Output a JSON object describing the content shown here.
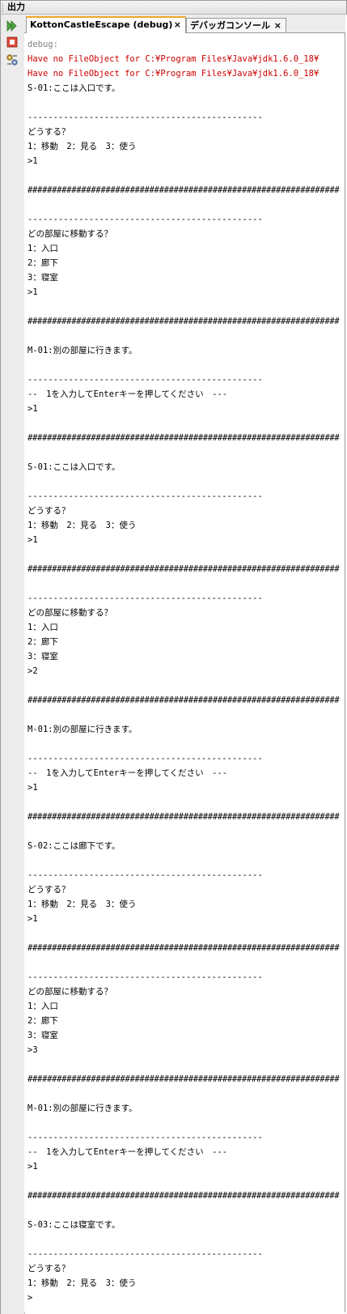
{
  "window": {
    "title": "出力"
  },
  "toolbar": {
    "buttons": [
      {
        "name": "rerun-icon"
      },
      {
        "name": "stop-icon"
      },
      {
        "name": "settings-icon"
      }
    ]
  },
  "tabs": [
    {
      "label": "KottonCastleEscape (debug)",
      "close": "×",
      "active": true
    },
    {
      "label": "デバッガコンソール",
      "close": "×",
      "active": false
    }
  ],
  "colors": {
    "debug_text": "#7f7f7f",
    "error_text": "#cc0000",
    "tab_accent": "#f5a623"
  },
  "console": {
    "lines": [
      {
        "text": "debug:",
        "type": "debug"
      },
      {
        "text": "Have no FileObject for C:¥Program Files¥Java¥jdk1.6.0_18¥",
        "type": "error"
      },
      {
        "text": "Have no FileObject for C:¥Program Files¥Java¥jdk1.6.0_18¥",
        "type": "error"
      },
      {
        "text": "S-01:ここは入口です。",
        "type": "normal"
      },
      {
        "text": "",
        "type": "normal"
      },
      {
        "text": "----------------------------------------------",
        "type": "normal"
      },
      {
        "text": "どうする？",
        "type": "normal"
      },
      {
        "text": "1：移動　2：見る　3：使う",
        "type": "normal"
      },
      {
        "text": ">1",
        "type": "normal"
      },
      {
        "text": "",
        "type": "normal"
      },
      {
        "text": "################################################################",
        "type": "hash"
      },
      {
        "text": "",
        "type": "normal"
      },
      {
        "text": "----------------------------------------------",
        "type": "normal"
      },
      {
        "text": "どの部屋に移動する？",
        "type": "normal"
      },
      {
        "text": "1：入口",
        "type": "normal"
      },
      {
        "text": "2：廊下",
        "type": "normal"
      },
      {
        "text": "3：寝室",
        "type": "normal"
      },
      {
        "text": ">1",
        "type": "normal"
      },
      {
        "text": "",
        "type": "normal"
      },
      {
        "text": "################################################################",
        "type": "hash"
      },
      {
        "text": "",
        "type": "normal"
      },
      {
        "text": "M-01:別の部屋に行きます。",
        "type": "normal"
      },
      {
        "text": "",
        "type": "normal"
      },
      {
        "text": "----------------------------------------------",
        "type": "normal"
      },
      {
        "text": "--　1を入力してEnterキーを押してください　---",
        "type": "normal"
      },
      {
        "text": ">1",
        "type": "normal"
      },
      {
        "text": "",
        "type": "normal"
      },
      {
        "text": "################################################################",
        "type": "hash"
      },
      {
        "text": "",
        "type": "normal"
      },
      {
        "text": "S-01:ここは入口です。",
        "type": "normal"
      },
      {
        "text": "",
        "type": "normal"
      },
      {
        "text": "----------------------------------------------",
        "type": "normal"
      },
      {
        "text": "どうする？",
        "type": "normal"
      },
      {
        "text": "1：移動　2：見る　3：使う",
        "type": "normal"
      },
      {
        "text": ">1",
        "type": "normal"
      },
      {
        "text": "",
        "type": "normal"
      },
      {
        "text": "################################################################",
        "type": "hash"
      },
      {
        "text": "",
        "type": "normal"
      },
      {
        "text": "----------------------------------------------",
        "type": "normal"
      },
      {
        "text": "どの部屋に移動する？",
        "type": "normal"
      },
      {
        "text": "1：入口",
        "type": "normal"
      },
      {
        "text": "2：廊下",
        "type": "normal"
      },
      {
        "text": "3：寝室",
        "type": "normal"
      },
      {
        "text": ">2",
        "type": "normal"
      },
      {
        "text": "",
        "type": "normal"
      },
      {
        "text": "################################################################",
        "type": "hash"
      },
      {
        "text": "",
        "type": "normal"
      },
      {
        "text": "M-01:別の部屋に行きます。",
        "type": "normal"
      },
      {
        "text": "",
        "type": "normal"
      },
      {
        "text": "----------------------------------------------",
        "type": "normal"
      },
      {
        "text": "--　1を入力してEnterキーを押してください　---",
        "type": "normal"
      },
      {
        "text": ">1",
        "type": "normal"
      },
      {
        "text": "",
        "type": "normal"
      },
      {
        "text": "################################################################",
        "type": "hash"
      },
      {
        "text": "",
        "type": "normal"
      },
      {
        "text": "S-02:ここは廊下です。",
        "type": "normal"
      },
      {
        "text": "",
        "type": "normal"
      },
      {
        "text": "----------------------------------------------",
        "type": "normal"
      },
      {
        "text": "どうする？",
        "type": "normal"
      },
      {
        "text": "1：移動　2：見る　3：使う",
        "type": "normal"
      },
      {
        "text": ">1",
        "type": "normal"
      },
      {
        "text": "",
        "type": "normal"
      },
      {
        "text": "################################################################",
        "type": "hash"
      },
      {
        "text": "",
        "type": "normal"
      },
      {
        "text": "----------------------------------------------",
        "type": "normal"
      },
      {
        "text": "どの部屋に移動する？",
        "type": "normal"
      },
      {
        "text": "1：入口",
        "type": "normal"
      },
      {
        "text": "2：廊下",
        "type": "normal"
      },
      {
        "text": "3：寝室",
        "type": "normal"
      },
      {
        "text": ">3",
        "type": "normal"
      },
      {
        "text": "",
        "type": "normal"
      },
      {
        "text": "################################################################",
        "type": "hash"
      },
      {
        "text": "",
        "type": "normal"
      },
      {
        "text": "M-01:別の部屋に行きます。",
        "type": "normal"
      },
      {
        "text": "",
        "type": "normal"
      },
      {
        "text": "----------------------------------------------",
        "type": "normal"
      },
      {
        "text": "--　1を入力してEnterキーを押してください　---",
        "type": "normal"
      },
      {
        "text": ">1",
        "type": "normal"
      },
      {
        "text": "",
        "type": "normal"
      },
      {
        "text": "################################################################",
        "type": "hash"
      },
      {
        "text": "",
        "type": "normal"
      },
      {
        "text": "S-03:ここは寝室です。",
        "type": "normal"
      },
      {
        "text": "",
        "type": "normal"
      },
      {
        "text": "----------------------------------------------",
        "type": "normal"
      },
      {
        "text": "どうする？",
        "type": "normal"
      },
      {
        "text": "1：移動　2：見る　3：使う",
        "type": "normal"
      },
      {
        "text": ">",
        "type": "normal"
      }
    ]
  }
}
